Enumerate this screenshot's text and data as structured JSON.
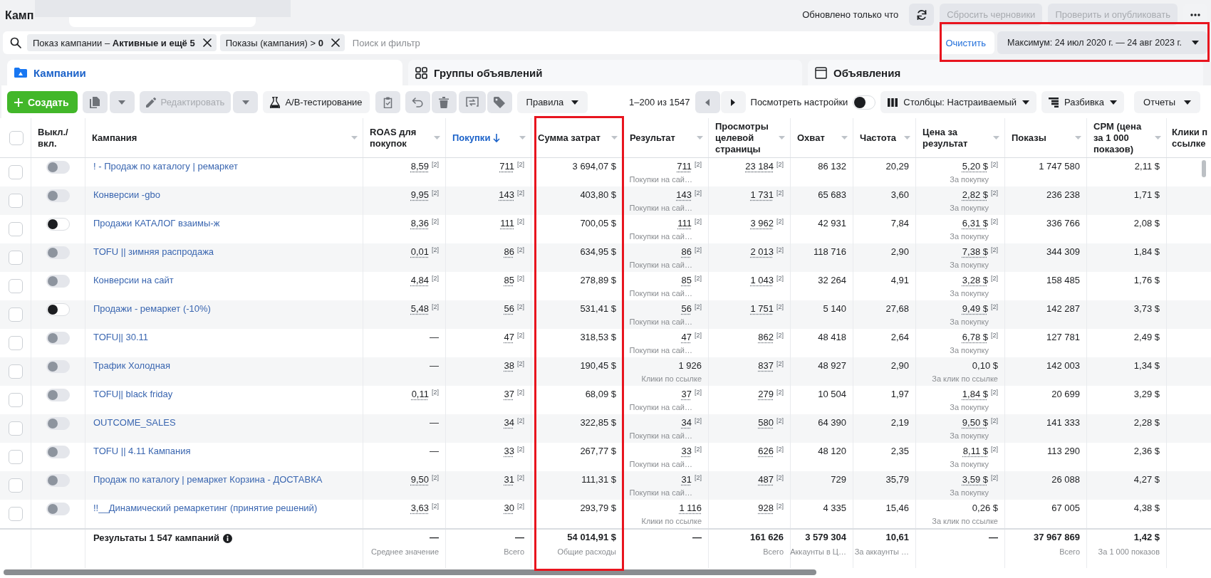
{
  "header": {
    "title": "Камп",
    "status": "Обновлено только что",
    "actions": [
      {
        "label": "Сбросить черновики",
        "disabled": true
      },
      {
        "label": "Проверить и опубликовать",
        "disabled": true
      }
    ]
  },
  "filters": {
    "chips": [
      {
        "label": "Показ кампании – **Активные и ещё 5**"
      },
      {
        "label": "Показы (кампания) > **0**"
      }
    ],
    "search": {
      "placeholder": "Поиск и фильтр"
    },
    "clear": "Очистить",
    "date_range": {
      "label": "Максимум: 24 июл 2020 г. — 24 авг 2023 г.",
      "highlighted": true
    }
  },
  "tabs": [
    {
      "label": "Кампании",
      "selected": true
    },
    {
      "label": "Группы объявлений",
      "selected": false
    },
    {
      "label": "Объявления",
      "selected": false
    }
  ],
  "toolbar": {
    "create": {
      "label": "Создать"
    },
    "tools": [
      {
        "kind": "duplicate",
        "disabled": true
      },
      {
        "kind": "dropdown",
        "disabled": true
      },
      {
        "kind": "edit",
        "label": "Редактировать",
        "disabled": true
      },
      {
        "kind": "dropdown",
        "disabled": true
      },
      {
        "kind": "ab_test",
        "label": "A/B-тестирование",
        "disabled": false
      },
      {
        "kind": "clipboard",
        "disabled": true
      },
      {
        "kind": "undo",
        "disabled": true
      },
      {
        "kind": "delete",
        "disabled": true
      },
      {
        "kind": "export",
        "disabled": true
      },
      {
        "kind": "tag",
        "disabled": true
      },
      {
        "kind": "rules",
        "label": "Правила",
        "disabled": false
      }
    ],
    "range": "1–200 из 1547",
    "prev": {
      "disabled": true
    },
    "next": {
      "disabled": false
    },
    "view_settings": {
      "label": "Посмотреть настройки",
      "on": false
    },
    "menus": [
      {
        "kind": "columns",
        "label": "Столбцы: Настраиваемый"
      },
      {
        "kind": "breakdown",
        "label": "Разбивка"
      },
      {
        "kind": "reports",
        "label": "Отчеты"
      }
    ]
  },
  "table": {
    "select_all": {
      "checked": false
    },
    "toggle_column": {
      "label": "Выкл./вкл."
    },
    "name_column": {
      "label": "Кампания",
      "sorted": false
    },
    "columns": [
      {
        "label": "ROAS для покупок",
        "kind": "metric",
        "sorted": false,
        "highlighted": false
      },
      {
        "label": "Покупки",
        "kind": "metric",
        "sorted": true,
        "highlighted": false
      },
      {
        "label": "Сумма затрат",
        "kind": "metric",
        "sorted": false,
        "highlighted": true
      },
      {
        "label": "Результат",
        "kind": "metric",
        "sorted": false,
        "highlighted": false
      },
      {
        "label": "Просмотры целевой страницы",
        "kind": "metric",
        "sorted": false,
        "highlighted": false
      },
      {
        "label": "Охват",
        "kind": "metric",
        "sorted": false,
        "highlighted": false
      },
      {
        "label": "Частота",
        "kind": "metric",
        "sorted": false,
        "highlighted": false
      },
      {
        "label": "Цена за результат",
        "kind": "metric",
        "sorted": false,
        "highlighted": false
      },
      {
        "label": "Показы",
        "kind": "metric",
        "sorted": false,
        "highlighted": false
      },
      {
        "label": "CPM (цена за 1 000 показов)",
        "kind": "metric",
        "sorted": false,
        "highlighted": false
      },
      {
        "label": "Клики п ссылке",
        "kind": "clipped",
        "sorted": false,
        "highlighted": false
      }
    ],
    "rows": [
      {
        "selected": false,
        "on": false,
        "disabled": true,
        "name": "! - Продаж по каталогу | ремаркет",
        "cells": [
          {
            "value": "8,59",
            "note": "[2]",
            "dotted": true
          },
          {
            "value": "711",
            "note": "[2]",
            "dotted": true
          },
          {
            "value": "3 694,07 $",
            "dotted": false
          },
          {
            "value": "711",
            "note": "[2]",
            "dotted": true,
            "caption": "Покупки на сай…"
          },
          {
            "value": "23 184",
            "note": "[2]",
            "dotted": true
          },
          {
            "value": "86 132",
            "dotted": false
          },
          {
            "value": "20,29",
            "dotted": false
          },
          {
            "value": "5,20 $",
            "note": "[2]",
            "dotted": true,
            "caption": "За покупку"
          },
          {
            "value": "1 747 580",
            "dotted": false
          },
          {
            "value": "2,11 $",
            "dotted": false
          }
        ]
      },
      {
        "selected": false,
        "on": false,
        "disabled": true,
        "name": "Конверсии -gbo",
        "cells": [
          {
            "value": "9,95",
            "note": "[2]",
            "dotted": true
          },
          {
            "value": "143",
            "note": "[2]",
            "dotted": true
          },
          {
            "value": "403,80 $",
            "dotted": false
          },
          {
            "value": "143",
            "note": "[2]",
            "dotted": true,
            "caption": "Покупки на сай…"
          },
          {
            "value": "1 731",
            "note": "[2]",
            "dotted": true
          },
          {
            "value": "65 683",
            "dotted": false
          },
          {
            "value": "3,60",
            "dotted": false
          },
          {
            "value": "2,82 $",
            "note": "[2]",
            "dotted": true,
            "caption": "За покупку"
          },
          {
            "value": "236 238",
            "dotted": false
          },
          {
            "value": "1,71 $",
            "dotted": false
          }
        ]
      },
      {
        "selected": false,
        "on": false,
        "disabled": false,
        "name": "Продажи КАТАЛОГ взаимы-ж",
        "cells": [
          {
            "value": "8,36",
            "note": "[2]",
            "dotted": true
          },
          {
            "value": "111",
            "note": "[2]",
            "dotted": true
          },
          {
            "value": "700,05 $",
            "dotted": false
          },
          {
            "value": "111",
            "note": "[2]",
            "dotted": true,
            "caption": "Покупки на сай…"
          },
          {
            "value": "3 962",
            "note": "[2]",
            "dotted": true
          },
          {
            "value": "42 931",
            "dotted": false
          },
          {
            "value": "7,84",
            "dotted": false
          },
          {
            "value": "6,31 $",
            "note": "[2]",
            "dotted": true,
            "caption": "За покупку"
          },
          {
            "value": "336 766",
            "dotted": false
          },
          {
            "value": "2,08 $",
            "dotted": false
          }
        ]
      },
      {
        "selected": false,
        "on": false,
        "disabled": true,
        "name": "TOFU || зимняя распродажа",
        "cells": [
          {
            "value": "0,01",
            "note": "[2]",
            "dotted": true
          },
          {
            "value": "86",
            "note": "[2]",
            "dotted": true
          },
          {
            "value": "634,95 $",
            "dotted": false
          },
          {
            "value": "86",
            "note": "[2]",
            "dotted": true,
            "caption": "Покупки на сай…"
          },
          {
            "value": "2 013",
            "note": "[2]",
            "dotted": true
          },
          {
            "value": "118 716",
            "dotted": false
          },
          {
            "value": "2,90",
            "dotted": false
          },
          {
            "value": "7,38 $",
            "note": "[2]",
            "dotted": true,
            "caption": "За покупку"
          },
          {
            "value": "344 309",
            "dotted": false
          },
          {
            "value": "1,84 $",
            "dotted": false
          }
        ]
      },
      {
        "selected": false,
        "on": false,
        "disabled": true,
        "name": "Конверсии на сайт",
        "cells": [
          {
            "value": "4,84",
            "note": "[2]",
            "dotted": true
          },
          {
            "value": "85",
            "note": "[2]",
            "dotted": true
          },
          {
            "value": "278,89 $",
            "dotted": false
          },
          {
            "value": "85",
            "note": "[2]",
            "dotted": true,
            "caption": "Покупки на сай…"
          },
          {
            "value": "1 043",
            "note": "[2]",
            "dotted": true
          },
          {
            "value": "32 264",
            "dotted": false
          },
          {
            "value": "4,91",
            "dotted": false
          },
          {
            "value": "3,28 $",
            "note": "[2]",
            "dotted": true,
            "caption": "За покупку"
          },
          {
            "value": "158 485",
            "dotted": false
          },
          {
            "value": "1,76 $",
            "dotted": false
          }
        ]
      },
      {
        "selected": false,
        "on": false,
        "disabled": false,
        "name": "Продажи - ремаркет (-10%)",
        "cells": [
          {
            "value": "5,48",
            "note": "[2]",
            "dotted": true
          },
          {
            "value": "56",
            "note": "[2]",
            "dotted": true
          },
          {
            "value": "531,41 $",
            "dotted": false
          },
          {
            "value": "56",
            "note": "[2]",
            "dotted": true,
            "caption": "Покупки на сай…"
          },
          {
            "value": "1 751",
            "note": "[2]",
            "dotted": true
          },
          {
            "value": "5 140",
            "dotted": false
          },
          {
            "value": "27,68",
            "dotted": false
          },
          {
            "value": "9,49 $",
            "note": "[2]",
            "dotted": true,
            "caption": "За покупку"
          },
          {
            "value": "142 287",
            "dotted": false
          },
          {
            "value": "3,73 $",
            "dotted": false
          }
        ]
      },
      {
        "selected": false,
        "on": false,
        "disabled": true,
        "name": "TOFU|| 30.11",
        "cells": [
          {
            "value": "—",
            "dotted": false
          },
          {
            "value": "47",
            "note": "[2]",
            "dotted": true
          },
          {
            "value": "318,53 $",
            "dotted": false
          },
          {
            "value": "47",
            "note": "[2]",
            "dotted": true,
            "caption": "Покупки на сай…"
          },
          {
            "value": "862",
            "note": "[2]",
            "dotted": true
          },
          {
            "value": "48 418",
            "dotted": false
          },
          {
            "value": "2,64",
            "dotted": false
          },
          {
            "value": "6,78 $",
            "note": "[2]",
            "dotted": true,
            "caption": "За покупку"
          },
          {
            "value": "127 781",
            "dotted": false
          },
          {
            "value": "2,49 $",
            "dotted": false
          }
        ]
      },
      {
        "selected": false,
        "on": false,
        "disabled": true,
        "name": "Трафик Холодная",
        "cells": [
          {
            "value": "—",
            "dotted": false
          },
          {
            "value": "38",
            "note": "[2]",
            "dotted": true
          },
          {
            "value": "190,45 $",
            "dotted": false
          },
          {
            "value": "1 926",
            "dotted": false,
            "caption": "Клики по ссылке"
          },
          {
            "value": "837",
            "note": "[2]",
            "dotted": true
          },
          {
            "value": "48 927",
            "dotted": false
          },
          {
            "value": "2,90",
            "dotted": false
          },
          {
            "value": "0,10 $",
            "dotted": false,
            "caption": "За клик по ссылке"
          },
          {
            "value": "142 003",
            "dotted": false
          },
          {
            "value": "1,34 $",
            "dotted": false
          }
        ]
      },
      {
        "selected": false,
        "on": false,
        "disabled": true,
        "name": "TOFU|| black friday",
        "cells": [
          {
            "value": "0,11",
            "note": "[2]",
            "dotted": true
          },
          {
            "value": "37",
            "note": "[2]",
            "dotted": true
          },
          {
            "value": "68,09 $",
            "dotted": false
          },
          {
            "value": "37",
            "note": "[2]",
            "dotted": true,
            "caption": "Покупки на сай…"
          },
          {
            "value": "279",
            "note": "[2]",
            "dotted": true
          },
          {
            "value": "10 504",
            "dotted": false
          },
          {
            "value": "1,97",
            "dotted": false
          },
          {
            "value": "1,84 $",
            "note": "[2]",
            "dotted": true,
            "caption": "За покупку"
          },
          {
            "value": "20 699",
            "dotted": false
          },
          {
            "value": "3,29 $",
            "dotted": false
          }
        ]
      },
      {
        "selected": false,
        "on": false,
        "disabled": true,
        "name": "OUTCOME_SALES",
        "cells": [
          {
            "value": "—",
            "dotted": false
          },
          {
            "value": "34",
            "note": "[2]",
            "dotted": true
          },
          {
            "value": "322,85 $",
            "dotted": false
          },
          {
            "value": "34",
            "note": "[2]",
            "dotted": true,
            "caption": "Покупки на сай…"
          },
          {
            "value": "580",
            "note": "[2]",
            "dotted": true
          },
          {
            "value": "64 390",
            "dotted": false
          },
          {
            "value": "2,19",
            "dotted": false
          },
          {
            "value": "9,50 $",
            "note": "[2]",
            "dotted": true,
            "caption": "За покупку"
          },
          {
            "value": "141 333",
            "dotted": false
          },
          {
            "value": "2,28 $",
            "dotted": false
          }
        ]
      },
      {
        "selected": false,
        "on": false,
        "disabled": true,
        "name": "TOFU || 4.11 Кампания",
        "cells": [
          {
            "value": "—",
            "dotted": false
          },
          {
            "value": "33",
            "note": "[2]",
            "dotted": true
          },
          {
            "value": "267,77 $",
            "dotted": false
          },
          {
            "value": "33",
            "note": "[2]",
            "dotted": true,
            "caption": "Покупки на сай…"
          },
          {
            "value": "626",
            "note": "[2]",
            "dotted": true
          },
          {
            "value": "48 120",
            "dotted": false
          },
          {
            "value": "2,35",
            "dotted": false
          },
          {
            "value": "8,11 $",
            "note": "[2]",
            "dotted": true,
            "caption": "За покупку"
          },
          {
            "value": "113 290",
            "dotted": false
          },
          {
            "value": "2,36 $",
            "dotted": false
          }
        ]
      },
      {
        "selected": false,
        "on": false,
        "disabled": true,
        "name": "Продаж по каталогу | ремаркет Корзина - ДОСТАВКА",
        "cells": [
          {
            "value": "9,50",
            "note": "[2]",
            "dotted": true
          },
          {
            "value": "31",
            "note": "[2]",
            "dotted": true
          },
          {
            "value": "111,31 $",
            "dotted": false
          },
          {
            "value": "31",
            "note": "[2]",
            "dotted": true,
            "caption": "Покупки на сай…"
          },
          {
            "value": "487",
            "note": "[2]",
            "dotted": true
          },
          {
            "value": "729",
            "dotted": false
          },
          {
            "value": "35,79",
            "dotted": false
          },
          {
            "value": "3,59 $",
            "note": "[2]",
            "dotted": true,
            "caption": "За покупку"
          },
          {
            "value": "26 088",
            "dotted": false
          },
          {
            "value": "4,27 $",
            "dotted": false
          }
        ]
      },
      {
        "selected": false,
        "on": false,
        "disabled": true,
        "name": "!!__Динамический ремаркетинг (принятие решений)",
        "cells": [
          {
            "value": "3,63",
            "note": "[2]",
            "dotted": true
          },
          {
            "value": "30",
            "note": "[2]",
            "dotted": true
          },
          {
            "value": "293,79 $",
            "dotted": false
          },
          {
            "value": "1 116",
            "dotted": true,
            "caption": "Клики по ссылке"
          },
          {
            "value": "928",
            "note": "[2]",
            "dotted": true
          },
          {
            "value": "4 335",
            "dotted": false
          },
          {
            "value": "15,46",
            "dotted": false
          },
          {
            "value": "0,26 $",
            "dotted": false,
            "caption": "За клик по ссылке"
          },
          {
            "value": "67 005",
            "dotted": false
          },
          {
            "value": "4,38 $",
            "dotted": false
          }
        ]
      }
    ],
    "summary": {
      "label": "Результаты 1 547 кампаний",
      "cells": [
        {
          "value": "—",
          "caption": "Среднее значение"
        },
        {
          "value": "—",
          "caption": "Всего"
        },
        {
          "value": "54 014,91 $",
          "caption": "Общие расходы"
        },
        {
          "value": "—"
        },
        {
          "value": "161 626",
          "caption": "Всего"
        },
        {
          "value": "3 579 304",
          "caption": "Аккаунты в Ц…"
        },
        {
          "value": "10,61",
          "caption": "За аккаунты …"
        },
        {
          "value": "—"
        },
        {
          "value": "37 967 869",
          "caption": "Всего"
        },
        {
          "value": "1,42 $",
          "caption": "За 1 000 показов"
        }
      ]
    }
  }
}
